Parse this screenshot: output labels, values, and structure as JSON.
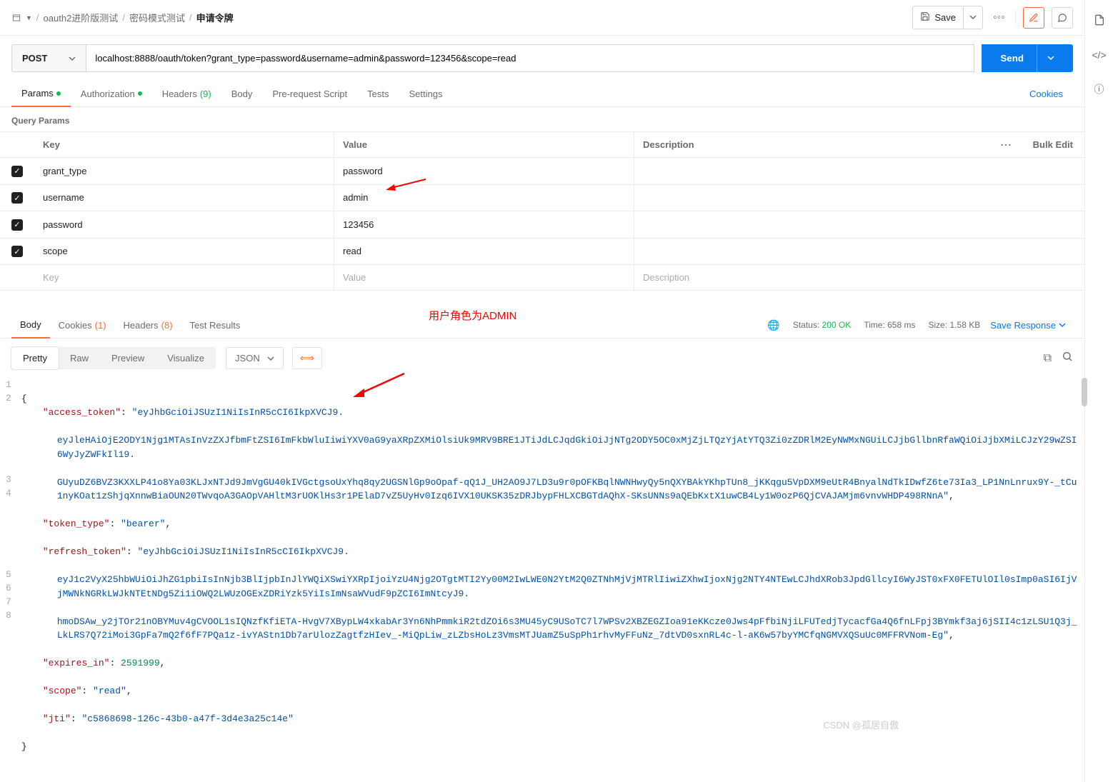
{
  "breadcrumb": {
    "collection": "oauth2进阶版测试",
    "folder": "密码模式测试",
    "current": "申请令牌"
  },
  "top": {
    "save": "Save"
  },
  "request": {
    "method": "POST",
    "url": "localhost:8888/oauth/token?grant_type=password&username=admin&password=123456&scope=read",
    "send": "Send"
  },
  "tabs": {
    "params": "Params",
    "auth": "Authorization",
    "headers": "Headers",
    "headers_count": "(9)",
    "body": "Body",
    "prereq": "Pre-request Script",
    "tests": "Tests",
    "settings": "Settings",
    "cookies": "Cookies"
  },
  "query_params": {
    "label": "Query Params",
    "headers": {
      "key": "Key",
      "value": "Value",
      "desc": "Description",
      "bulk": "Bulk Edit"
    },
    "rows": [
      {
        "key": "grant_type",
        "value": "password",
        "desc": ""
      },
      {
        "key": "username",
        "value": "admin",
        "desc": ""
      },
      {
        "key": "password",
        "value": "123456",
        "desc": ""
      },
      {
        "key": "scope",
        "value": "read",
        "desc": ""
      }
    ],
    "placeholders": {
      "key": "Key",
      "value": "Value",
      "desc": "Description"
    }
  },
  "annotation": {
    "role": "用户角色为ADMIN"
  },
  "response_tabs": {
    "body": "Body",
    "cookies": "Cookies",
    "cookies_count": "(1)",
    "headers": "Headers",
    "headers_count": "(8)",
    "tests": "Test Results"
  },
  "resp_meta": {
    "status_label": "Status:",
    "status_value": "200 OK",
    "time_label": "Time:",
    "time_value": "658 ms",
    "size_label": "Size:",
    "size_value": "1.58 KB",
    "save_resp": "Save Response"
  },
  "view": {
    "pretty": "Pretty",
    "raw": "Raw",
    "preview": "Preview",
    "visualize": "Visualize",
    "json": "JSON"
  },
  "json_body": {
    "access_token_key": "\"access_token\"",
    "access_token_l1": "\"eyJhbGciOiJSUzI1NiIsInR5cCI6IkpXVCJ9.",
    "access_token_l2": "eyJleHAiOjE2ODY1Njg1MTAsInVzZXJfbmFtZSI6ImFkbWluIiwiYXV0aG9yaXRpZXMiOlsiUk9MRV9BRE1JTiJdLCJqdGkiOiJjNTg2ODY5OC0xMjZjLTQzYjAtYTQ3Zi0zZDRlM2EyNWMxNGUiLCJjbGllbnRfaWQiOiJjbXMiLCJzY29wZSI6WyJyZWFkIl19.",
    "access_token_l3": "GUyuDZ6BVZ3KXXLP41o8Ya03KLJxNTJd9JmVgGU40kIVGctgsoUxYhq8qy2UGSNlGp9oOpaf-qQ1J_UH2AO9J7LD3u9r0pOFKBqlNWNHwyQy5nQXYBAkYKhpTUn8_jKKqgu5VpDXM9eUtR4BnyalNdTkIDwfZ6te73Ia3_LP1NnLnrux9Y-_tCu1nyKOat1zShjqXnnwBiaOUN20TWvqoA3GAOpVAHltM3rUOKlHs3r1PElaD7vZ5UyHv0Izq6IVX10UKSK35zDRJbypFHLXCBGTdAQhX-SKsUNNs9aQEbKxtX1uwCB4Ly1W0ozP6QjCVAJAMjm6vnvWHDP498RNnA\"",
    "token_type_key": "\"token_type\"",
    "token_type_val": "\"bearer\"",
    "refresh_token_key": "\"refresh_token\"",
    "refresh_token_l1": "\"eyJhbGciOiJSUzI1NiIsInR5cCI6IkpXVCJ9.",
    "refresh_token_l2": "eyJ1c2VyX25hbWUiOiJhZG1pbiIsInNjb3BlIjpbInJlYWQiXSwiYXRpIjoiYzU4Njg2OTgtMTI2Yy00M2IwLWE0N2YtM2Q0ZTNhMjVjMTRlIiwiZXhwIjoxNjg2NTY4NTEwLCJhdXRob3JpdGllcyI6WyJST0xFX0FETUlOIl0sImp0aSI6IjVjMWNkNGRkLWJkNTEtNDg5Zi1iOWQ2LWUzOGExZDRiYzk5YiIsImNsaWVudF9pZCI6ImNtcyJ9.",
    "refresh_token_l3": "hmoDSAw_y2jTOr21nOBYMuv4gCVOOL1sIQNzfKfiETA-HvgV7XBypLW4xkabAr3Yn6NhPmmkiR2tdZOi6s3MU45yC9USoTC7l7WPSv2XBZEGZIoa91eKKcze0Jws4pFfbiNjiLFUTedjTycacfGa4Q6fnLFpj3BYmkf3aj6jSII4c1zLSU1Q3j_LkLRS7Q72iMoi3GpFa7mQ2f6fF7PQa1z-ivYAStn1Db7arUlozZagtfzHIev_-MiQpLiw_zLZbsHoLz3VmsMTJUamZ5uSpPh1rhvMyFFuNz_7dtVD0sxnRL4c-l-aK6w57byYMCfqNGMVXQSuUc0MFFRVNom-Eg\"",
    "expires_in_key": "\"expires_in\"",
    "expires_in_val": "2591999",
    "scope_key": "\"scope\"",
    "scope_val": "\"read\"",
    "jti_key": "\"jti\"",
    "jti_val": "\"c5868698-126c-43b0-a47f-3d4e3a25c14e\""
  },
  "watermark": "CSDN @孤居自傲"
}
